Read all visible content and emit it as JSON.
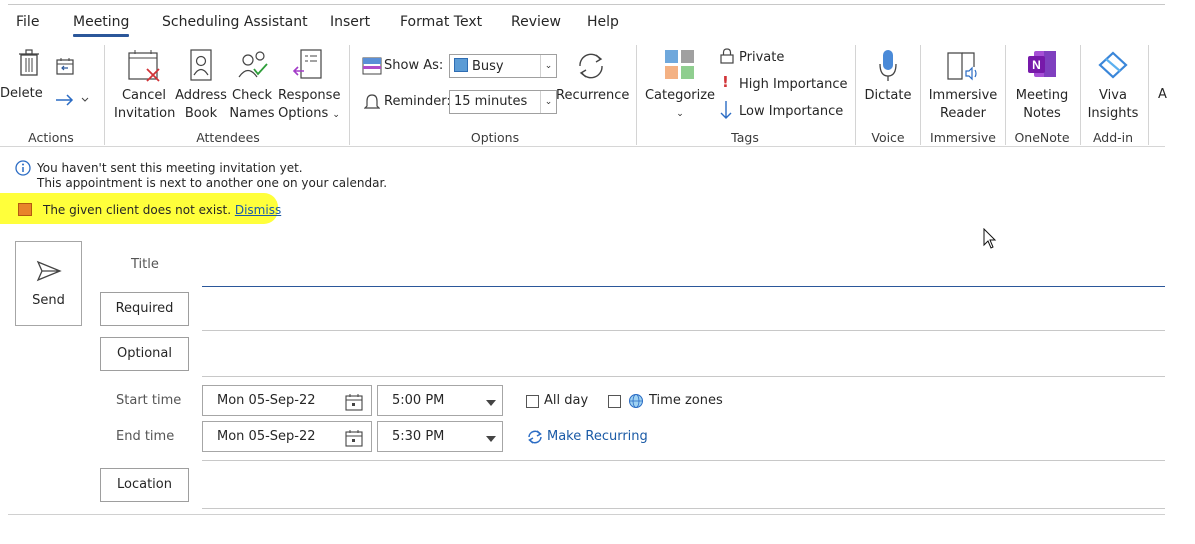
{
  "menu": {
    "tabs": [
      "File",
      "Meeting",
      "Scheduling Assistant",
      "Insert",
      "Format Text",
      "Review",
      "Help"
    ],
    "active": "Meeting"
  },
  "ribbon": {
    "actions": {
      "delete": "Delete",
      "group": "Actions"
    },
    "attendees": {
      "cancel_l1": "Cancel",
      "cancel_l2": "Invitation",
      "address_l1": "Address",
      "address_l2": "Book",
      "check_l1": "Check",
      "check_l2": "Names",
      "response_l1": "Response",
      "response_l2": "Options",
      "group": "Attendees"
    },
    "options": {
      "show_as_label": "Show As:",
      "show_as_value": "Busy",
      "reminder_label": "Reminder:",
      "reminder_value": "15 minutes",
      "recurrence": "Recurrence",
      "group": "Options"
    },
    "tags": {
      "categorize": "Categorize",
      "private": "Private",
      "high": "High Importance",
      "low": "Low Importance",
      "group": "Tags"
    },
    "voice": {
      "dictate": "Dictate",
      "group": "Voice"
    },
    "immersive": {
      "l1": "Immersive",
      "l2": "Reader",
      "group": "Immersive"
    },
    "onenote": {
      "l1": "Meeting",
      "l2": "Notes",
      "group": "OneNote"
    },
    "addin": {
      "l1": "Viva",
      "l2": "Insights",
      "group": "Add-in"
    },
    "overflow": "A"
  },
  "info": {
    "line1": "You haven't sent this meeting invitation yet.",
    "line2": "This appointment is next to another one on your calendar.",
    "error": "The given client does not exist.",
    "dismiss": "Dismiss"
  },
  "form": {
    "send": "Send",
    "title_label": "Title",
    "required": "Required",
    "optional": "Optional",
    "start_label": "Start time",
    "end_label": "End time",
    "start_date": "Mon 05-Sep-22",
    "start_time": "5:00 PM",
    "end_date": "Mon 05-Sep-22",
    "end_time": "5:30 PM",
    "all_day": "All day",
    "time_zones": "Time zones",
    "make_recurring": "Make Recurring",
    "location": "Location"
  },
  "colors": {
    "accent": "#2b579a",
    "highlight": "#ffff3b",
    "error_icon": "#e8842a",
    "link": "#1a5aa6",
    "onenote": "#7719aa"
  }
}
